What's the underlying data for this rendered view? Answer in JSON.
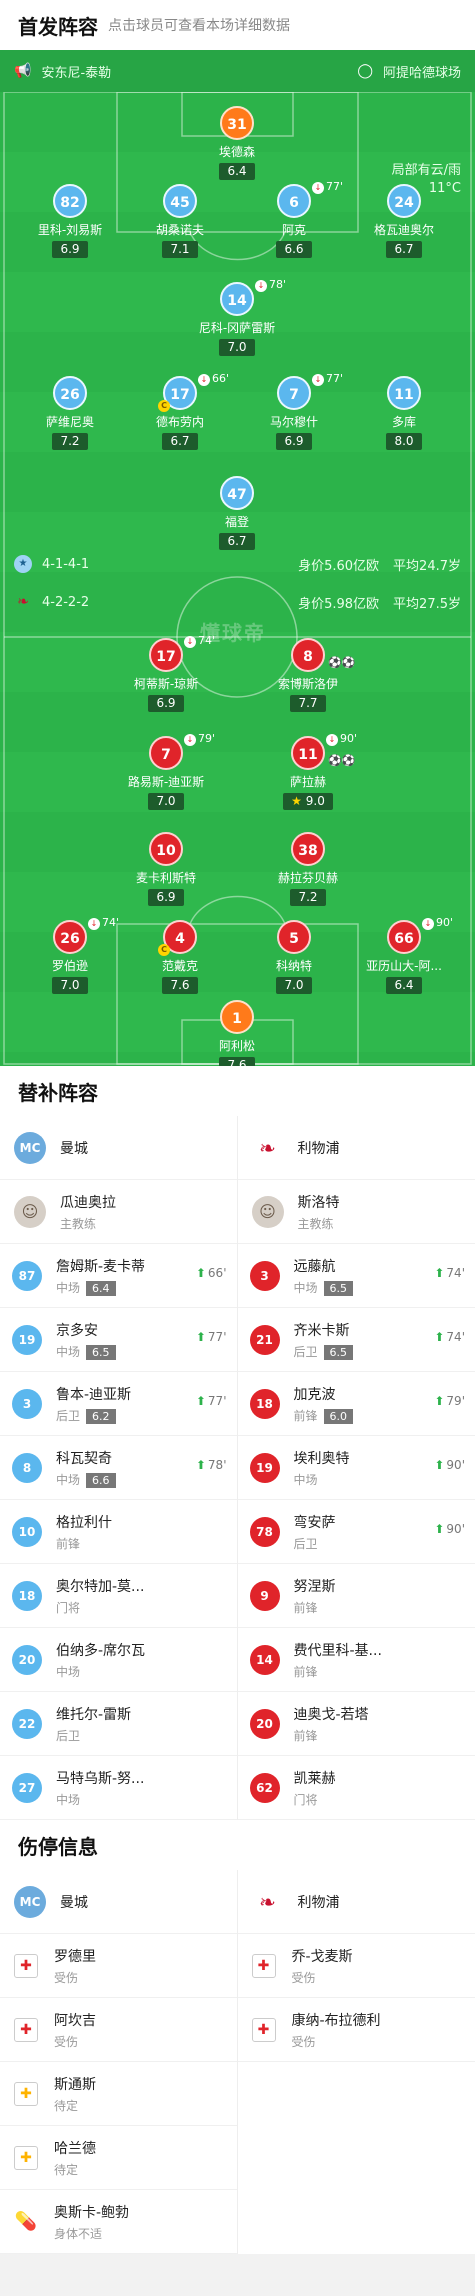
{
  "lineup": {
    "title": "首发阵容",
    "hint": "点击球员可查看本场详细数据"
  },
  "venue": {
    "left": "安东尼-泰勒",
    "right": "阿提哈德球场"
  },
  "weather": {
    "line1": "局部有云/雨",
    "line2": "11°C"
  },
  "watermark": "懂球帝",
  "home": {
    "formation": "4-1-4-1",
    "value": "身价5.60亿欧",
    "age": "平均24.7岁",
    "players": [
      {
        "no": "31",
        "name": "埃德森",
        "rating": "6.4"
      },
      {
        "no": "82",
        "name": "里科-刘易斯",
        "rating": "6.9"
      },
      {
        "no": "45",
        "name": "胡桑诺夫",
        "rating": "7.1"
      },
      {
        "no": "6",
        "name": "阿克",
        "rating": "6.6",
        "sub": "77'"
      },
      {
        "no": "24",
        "name": "格瓦迪奥尔",
        "rating": "6.7"
      },
      {
        "no": "14",
        "name": "尼科-冈萨雷斯",
        "rating": "7.0",
        "sub": "78'"
      },
      {
        "no": "26",
        "name": "萨维尼奥",
        "rating": "7.2"
      },
      {
        "no": "17",
        "name": "德布劳内",
        "rating": "6.7",
        "sub": "66'"
      },
      {
        "no": "7",
        "name": "马尔穆什",
        "rating": "6.9",
        "sub": "77'"
      },
      {
        "no": "11",
        "name": "多库",
        "rating": "8.0"
      },
      {
        "no": "47",
        "name": "福登",
        "rating": "6.7"
      }
    ]
  },
  "away": {
    "formation": "4-2-2-2",
    "value": "身价5.98亿欧",
    "age": "平均27.5岁",
    "players": [
      {
        "no": "17",
        "name": "柯蒂斯-琼斯",
        "rating": "6.9",
        "sub": "74'"
      },
      {
        "no": "8",
        "name": "索博斯洛伊",
        "rating": "7.7"
      },
      {
        "no": "7",
        "name": "路易斯-迪亚斯",
        "rating": "7.0",
        "sub": "79'"
      },
      {
        "no": "11",
        "name": "萨拉赫",
        "rating": "9.0",
        "sub": "90'"
      },
      {
        "no": "10",
        "name": "麦卡利斯特",
        "rating": "6.9"
      },
      {
        "no": "38",
        "name": "赫拉芬贝赫",
        "rating": "7.2"
      },
      {
        "no": "26",
        "name": "罗伯逊",
        "rating": "7.0",
        "sub": "74'"
      },
      {
        "no": "4",
        "name": "范戴克",
        "rating": "7.6"
      },
      {
        "no": "5",
        "name": "科纳特",
        "rating": "7.0"
      },
      {
        "no": "66",
        "name": "亚历山大-阿...",
        "rating": "6.4",
        "sub": "90'"
      },
      {
        "no": "1",
        "name": "阿利松",
        "rating": "7.6"
      }
    ]
  },
  "subs": {
    "title": "替补阵容",
    "home_team": "曼城",
    "away_team": "利物浦",
    "home_coach": {
      "name": "瓜迪奥拉",
      "role": "主教练"
    },
    "away_coach": {
      "name": "斯洛特",
      "role": "主教练"
    },
    "home": [
      {
        "no": "87",
        "name": "詹姆斯-麦卡蒂",
        "pos": "中场",
        "rating": "6.4",
        "in": "66'"
      },
      {
        "no": "19",
        "name": "京多安",
        "pos": "中场",
        "rating": "6.5",
        "in": "77'"
      },
      {
        "no": "3",
        "name": "鲁本-迪亚斯",
        "pos": "后卫",
        "rating": "6.2",
        "in": "77'"
      },
      {
        "no": "8",
        "name": "科瓦契奇",
        "pos": "中场",
        "rating": "6.6",
        "in": "78'"
      },
      {
        "no": "10",
        "name": "格拉利什",
        "pos": "前锋"
      },
      {
        "no": "18",
        "name": "奥尔特加-莫...",
        "pos": "门将"
      },
      {
        "no": "20",
        "name": "伯纳多-席尔瓦",
        "pos": "中场"
      },
      {
        "no": "22",
        "name": "维托尔-雷斯",
        "pos": "后卫"
      },
      {
        "no": "27",
        "name": "马特乌斯-努...",
        "pos": "中场"
      }
    ],
    "away": [
      {
        "no": "3",
        "name": "远藤航",
        "pos": "中场",
        "rating": "6.5",
        "in": "74'"
      },
      {
        "no": "21",
        "name": "齐米卡斯",
        "pos": "后卫",
        "rating": "6.5",
        "in": "74'"
      },
      {
        "no": "18",
        "name": "加克波",
        "pos": "前锋",
        "rating": "6.0",
        "in": "79'"
      },
      {
        "no": "19",
        "name": "埃利奥特",
        "pos": "中场",
        "in": "90'"
      },
      {
        "no": "78",
        "name": "弯安萨",
        "pos": "后卫",
        "in": "90'"
      },
      {
        "no": "9",
        "name": "努涅斯",
        "pos": "前锋"
      },
      {
        "no": "14",
        "name": "费代里科-基...",
        "pos": "前锋"
      },
      {
        "no": "20",
        "name": "迪奥戈-若塔",
        "pos": "前锋"
      },
      {
        "no": "62",
        "name": "凯莱赫",
        "pos": "门将"
      }
    ]
  },
  "injuries": {
    "title": "伤停信息",
    "home_team": "曼城",
    "away_team": "利物浦",
    "home": [
      {
        "name": "罗德里",
        "status": "受伤",
        "icon": "medkit"
      },
      {
        "name": "阿坎吉",
        "status": "受伤",
        "icon": "medkit"
      },
      {
        "name": "斯通斯",
        "status": "待定",
        "icon": "medkit-yellow"
      },
      {
        "name": "哈兰德",
        "status": "待定",
        "icon": "medkit-yellow"
      },
      {
        "name": "奥斯卡-鲍勃",
        "status": "身体不适",
        "icon": "pill"
      }
    ],
    "away": [
      {
        "name": "乔-戈麦斯",
        "status": "受伤",
        "icon": "medkit"
      },
      {
        "name": "康纳-布拉德利",
        "status": "受伤",
        "icon": "medkit"
      }
    ]
  }
}
